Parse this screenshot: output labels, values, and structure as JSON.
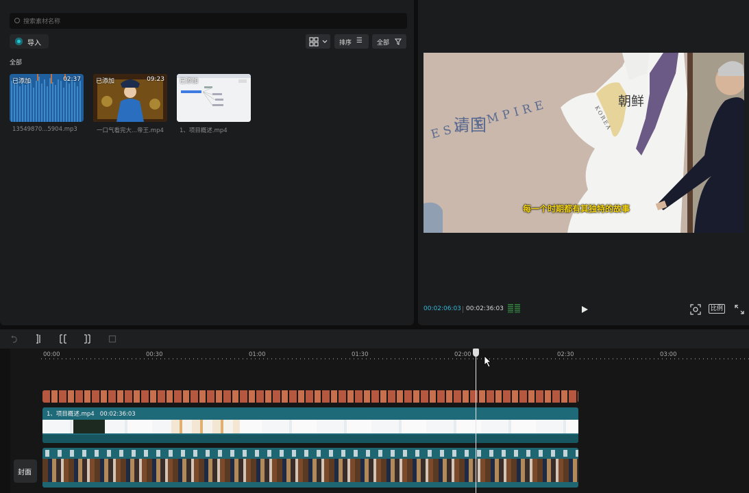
{
  "media": {
    "search_placeholder": "搜索素材名称",
    "import_label": "导入",
    "sort_label": "排序",
    "filter_label": "全部",
    "section_all": "全部",
    "items": [
      {
        "tag": "已添加",
        "duration": "02:37",
        "name": "13549870...5904.mp3"
      },
      {
        "tag": "已添加",
        "duration": "09:23",
        "name": "一口气看完大...帝王.mp4"
      },
      {
        "tag": "已添加",
        "duration": "",
        "name": "1、项目概述.mp4"
      }
    ]
  },
  "player": {
    "map_label_qing": "清国",
    "map_label_empire": "ESE EMPIRE",
    "map_label_chosun": "朝鲜",
    "map_label_korea": "KOREA",
    "subtitle": "每一个时期都有其独特的故事",
    "time_current": "00:02:06:03",
    "time_total": "00:02:36:03",
    "ratio_label": "比例"
  },
  "timeline": {
    "ruler_labels": [
      "00:00",
      "00:30",
      "01:00",
      "01:30",
      "02:00",
      "02:30",
      "03:00"
    ],
    "clip_title": "1、项目概述.mp4   00:02:36:03",
    "cover_label": "封面"
  },
  "colors": {
    "accent": "#35b8d5",
    "track_teal": "#1f6a78",
    "text_chip": "#b5583f",
    "audio_blue": "#1f5f9e"
  }
}
